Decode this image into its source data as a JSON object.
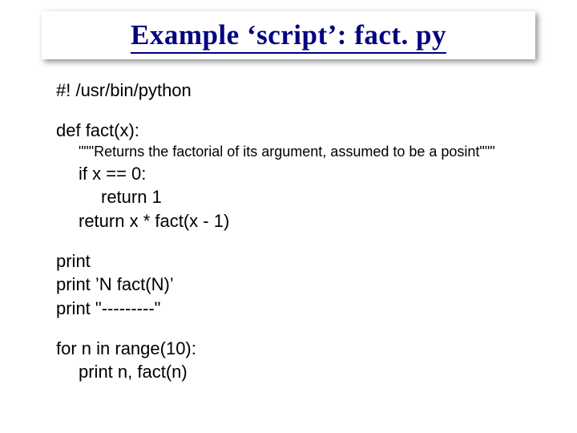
{
  "title": "Example ‘script’: fact. py",
  "code": {
    "shebang": "#! /usr/bin/python",
    "def": "def fact(x):",
    "doc": "\"\"\"Returns the factorial of its argument, assumed to be a posint\"\"\"",
    "ifline": "if x == 0:",
    "ret1": "return 1",
    "ret2": "return x * fact(x - 1)",
    "p1": "print",
    "p2": "print ’N fact(N)’",
    "p3": "print \"---------\"",
    "forline": "for n in range(10):",
    "printn": "print n, fact(n)"
  }
}
